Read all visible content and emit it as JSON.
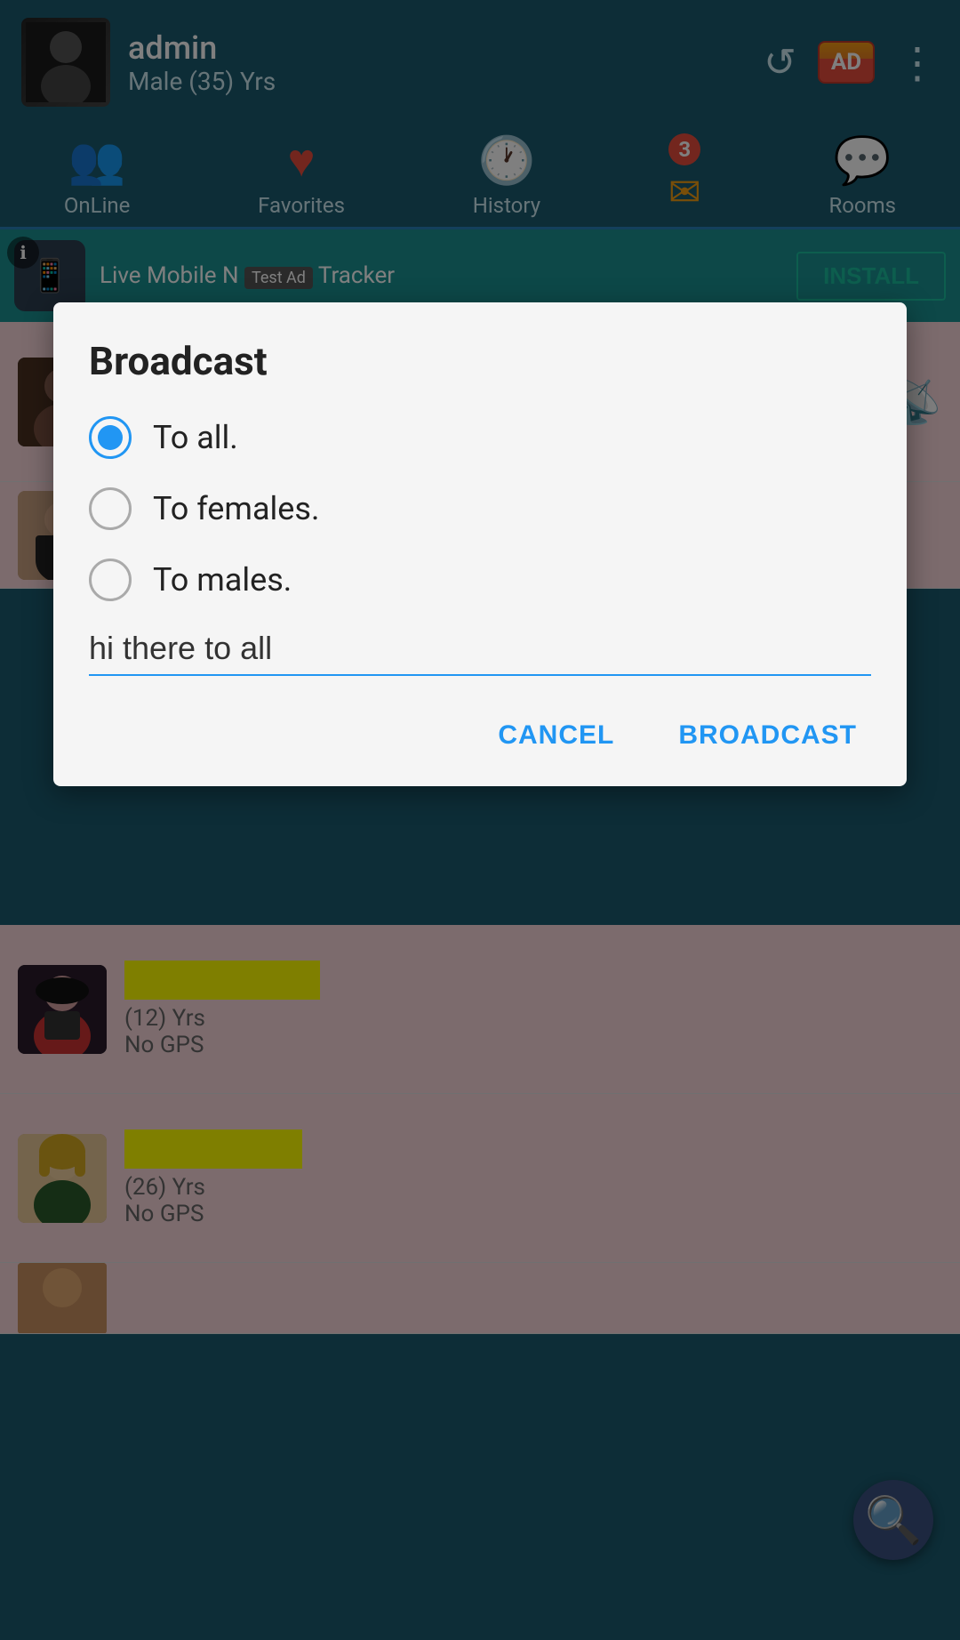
{
  "header": {
    "username": "admin",
    "user_meta": "Male (35) Yrs",
    "refresh_label": "↺",
    "ad_text": "AD",
    "more_label": "⋮"
  },
  "nav": {
    "tabs": [
      {
        "id": "online",
        "label": "OnLine",
        "icon": "👥",
        "active": false
      },
      {
        "id": "favorites",
        "label": "Favorites",
        "icon": "♥",
        "active": false
      },
      {
        "id": "history",
        "label": "History",
        "icon": "🕐",
        "active": false
      },
      {
        "id": "messages",
        "label": "3",
        "icon": "✉",
        "active": false
      },
      {
        "id": "rooms",
        "label": "Rooms",
        "icon": "💬",
        "active": false
      }
    ]
  },
  "ad_banner": {
    "title": "Live Mobile N",
    "subtitle": "Tracker",
    "ad_label": "Test Ad",
    "install_label": "INSTALL"
  },
  "dialog": {
    "title": "Broadcast",
    "options": [
      {
        "id": "to_all",
        "label": "To all.",
        "selected": true
      },
      {
        "id": "to_females",
        "label": "To females.",
        "selected": false
      },
      {
        "id": "to_males",
        "label": "To males.",
        "selected": false
      }
    ],
    "message_value": "hi there to all",
    "cancel_label": "CANCEL",
    "broadcast_label": "BROADCAST"
  },
  "user_list": [
    {
      "name_hidden": true,
      "age": "(12) Yrs",
      "gps": "No GPS"
    },
    {
      "name_hidden": true,
      "age": "(26) Yrs",
      "gps": "No GPS"
    }
  ],
  "fab": {
    "search_icon": "🔍"
  }
}
